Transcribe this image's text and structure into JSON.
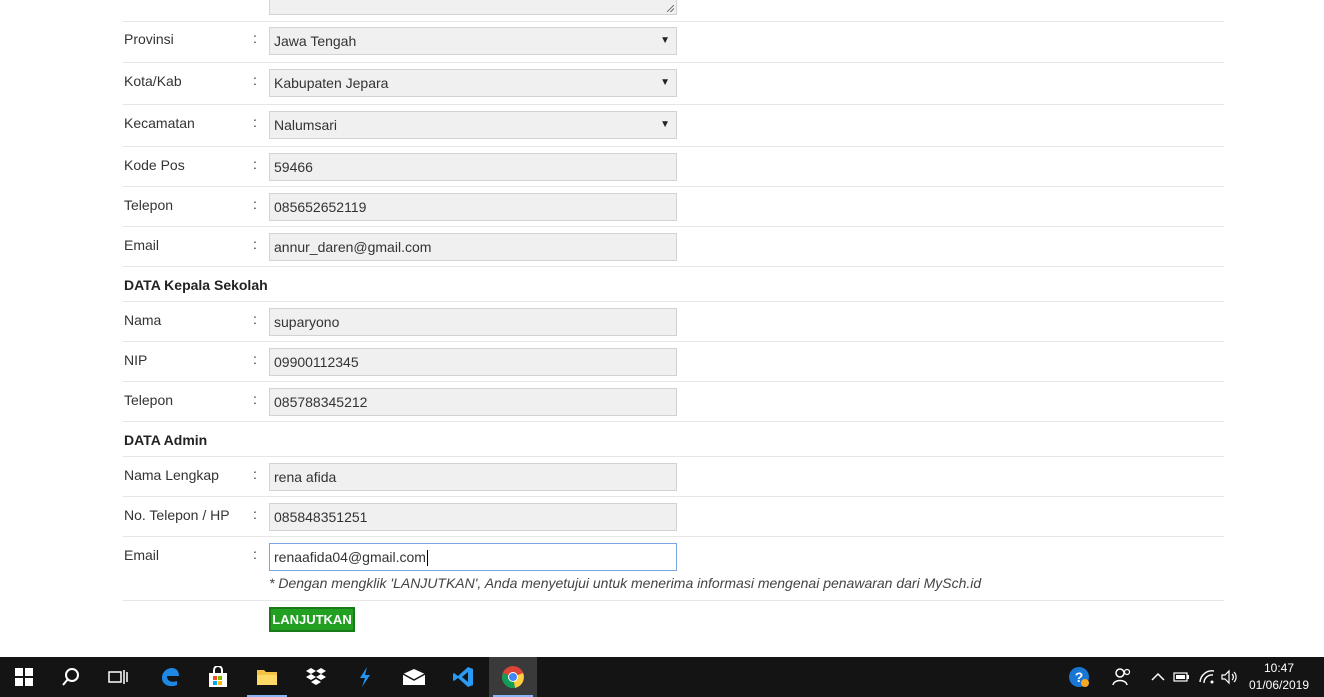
{
  "form": {
    "provinsi": {
      "label": "Provinsi",
      "colon": ":",
      "value": "Jawa Tengah"
    },
    "kota": {
      "label": "Kota/Kab",
      "colon": ":",
      "value": "Kabupaten Jepara"
    },
    "kecamatan": {
      "label": "Kecamatan",
      "colon": ":",
      "value": "Nalumsari"
    },
    "kode_pos": {
      "label": "Kode Pos",
      "colon": ":",
      "value": "59466"
    },
    "telepon": {
      "label": "Telepon",
      "colon": ":",
      "value": "085652652119"
    },
    "email": {
      "label": "Email",
      "colon": ":",
      "value": "annur_daren@gmail.com"
    }
  },
  "kepala": {
    "section_title": "DATA Kepala Sekolah",
    "nama": {
      "label": "Nama",
      "colon": ":",
      "value": "suparyono"
    },
    "nip": {
      "label": "NIP",
      "colon": ":",
      "value": "09900112345"
    },
    "telepon": {
      "label": "Telepon",
      "colon": ":",
      "value": "085788345212"
    }
  },
  "admin": {
    "section_title": "DATA Admin",
    "nama_lengkap": {
      "label": "Nama Lengkap",
      "colon": ":",
      "value": "rena afida"
    },
    "no_telepon": {
      "label": "No. Telepon / HP",
      "colon": ":",
      "value": "085848351251"
    },
    "email": {
      "label": "Email",
      "colon": ":",
      "value": "renaafida04@gmail.com"
    },
    "note": "* Dengan mengklik 'LANJUTKAN', Anda menyetujui untuk menerima informasi mengenai penawaran dari MySch.id",
    "submit_label": "LANJUTKAN"
  },
  "taskbar": {
    "icons": [
      "windows-start-icon",
      "search-icon",
      "task-view-icon",
      "edge-icon",
      "store-icon",
      "file-explorer-icon",
      "dropbox-icon",
      "sublime-icon",
      "mail-icon",
      "vscode-icon",
      "chrome-icon"
    ],
    "time": "10:47",
    "date": "01/06/2019"
  },
  "colors": {
    "submit_bg": "#22a022",
    "taskbar_bg": "#141414",
    "focus_border": "#7aa7e0"
  }
}
